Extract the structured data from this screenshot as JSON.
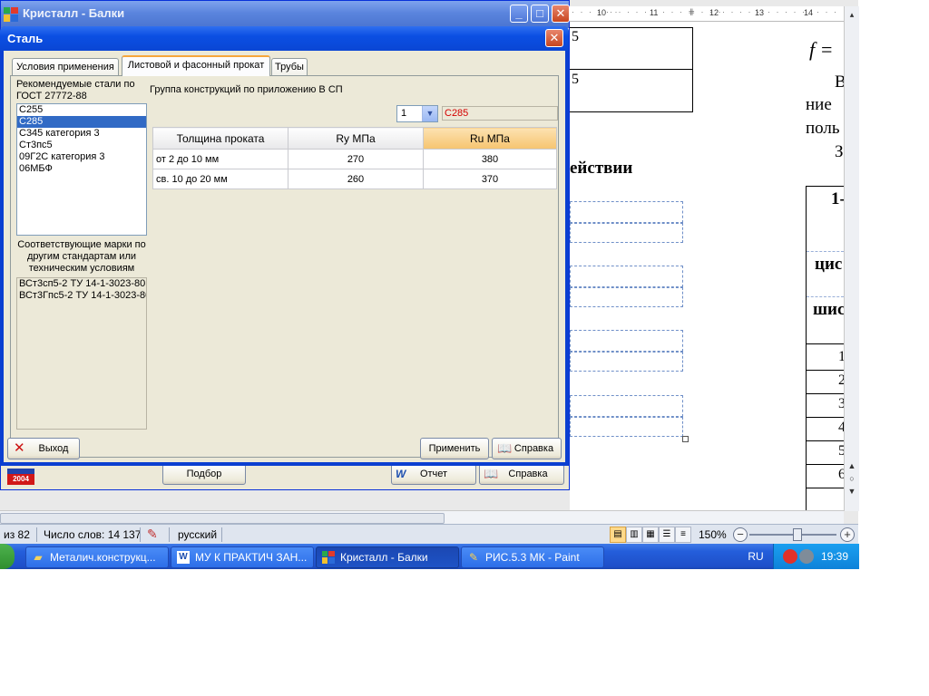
{
  "word": {
    "ruler_marks": [
      "10",
      "11",
      "12",
      "13",
      "14"
    ],
    "doc_fragments": {
      "cell1": "5",
      "cell2": "5",
      "formula": "f =",
      "line1": "В",
      "line2": "ние",
      "line3": "поль",
      "line4": "З",
      "heading": "ействии",
      "tcell1": "1-",
      "tcell2": "цис",
      "tcell3": "шис",
      "tcell4": "1",
      "tcell5": "2",
      "tcell6": "3",
      "tcell7": "4",
      "tcell8": "5",
      "tcell9": "6"
    },
    "status": {
      "pages": "из 82",
      "words": "Число слов: 14 137",
      "language": "русский",
      "zoom": "150%"
    }
  },
  "taskbar": {
    "items": [
      {
        "label": "Металич.конструкц...",
        "icon": "folder-icon"
      },
      {
        "label": "МУ К ПРАКТИЧ ЗАН...",
        "icon": "document-icon"
      },
      {
        "label": "Кристалл - Балки",
        "icon": "app-icon"
      },
      {
        "label": "РИС.5.3 МК - Paint",
        "icon": "paint-icon"
      }
    ],
    "lang": "RU",
    "clock": "19:39"
  },
  "main_window": {
    "title": "Кристалл - Балки",
    "badge": "2004",
    "buttons": {
      "select": "Подбор",
      "report": "Отчет",
      "help": "Справка"
    }
  },
  "dialog": {
    "title": "Сталь",
    "tabs": [
      "Условия применения",
      "Листовой и фасонный прокат",
      "Трубы"
    ],
    "active_tab": 1,
    "recommended_label": "Рекомендуемые стали по ГОСТ 27772-88",
    "steels": [
      "С255",
      "С285",
      "С345  категория 3",
      "Ст3пс5",
      "09Г2С категория 3",
      "06МБФ"
    ],
    "selected_steel": 1,
    "equivalents_label": "Соответствующие марки по другим стандартам или техническим условиям",
    "equivalents": [
      "ВСт3сп5-2 ТУ 14-1-3023-80",
      "ВСт3Гпс5-2 ТУ 14-1-3023-80"
    ],
    "group_label": "Группа конструкций по приложению В СП",
    "group_value": "1",
    "steel_value": "С285",
    "table": {
      "headers": [
        "Толщина проката",
        "Ry МПа",
        "Ru МПа"
      ],
      "rows": [
        [
          "от 2 до 10 мм",
          "270",
          "380"
        ],
        [
          "св. 10 до 20 мм",
          "260",
          "370"
        ]
      ]
    },
    "buttons": {
      "exit": "Выход",
      "apply": "Применить",
      "help": "Справка"
    }
  },
  "colors": {
    "title_blue": "#0b4fe3",
    "selection": "#316ac5",
    "highlight_header": "#f6c46f",
    "steel_red": "#d40000"
  }
}
